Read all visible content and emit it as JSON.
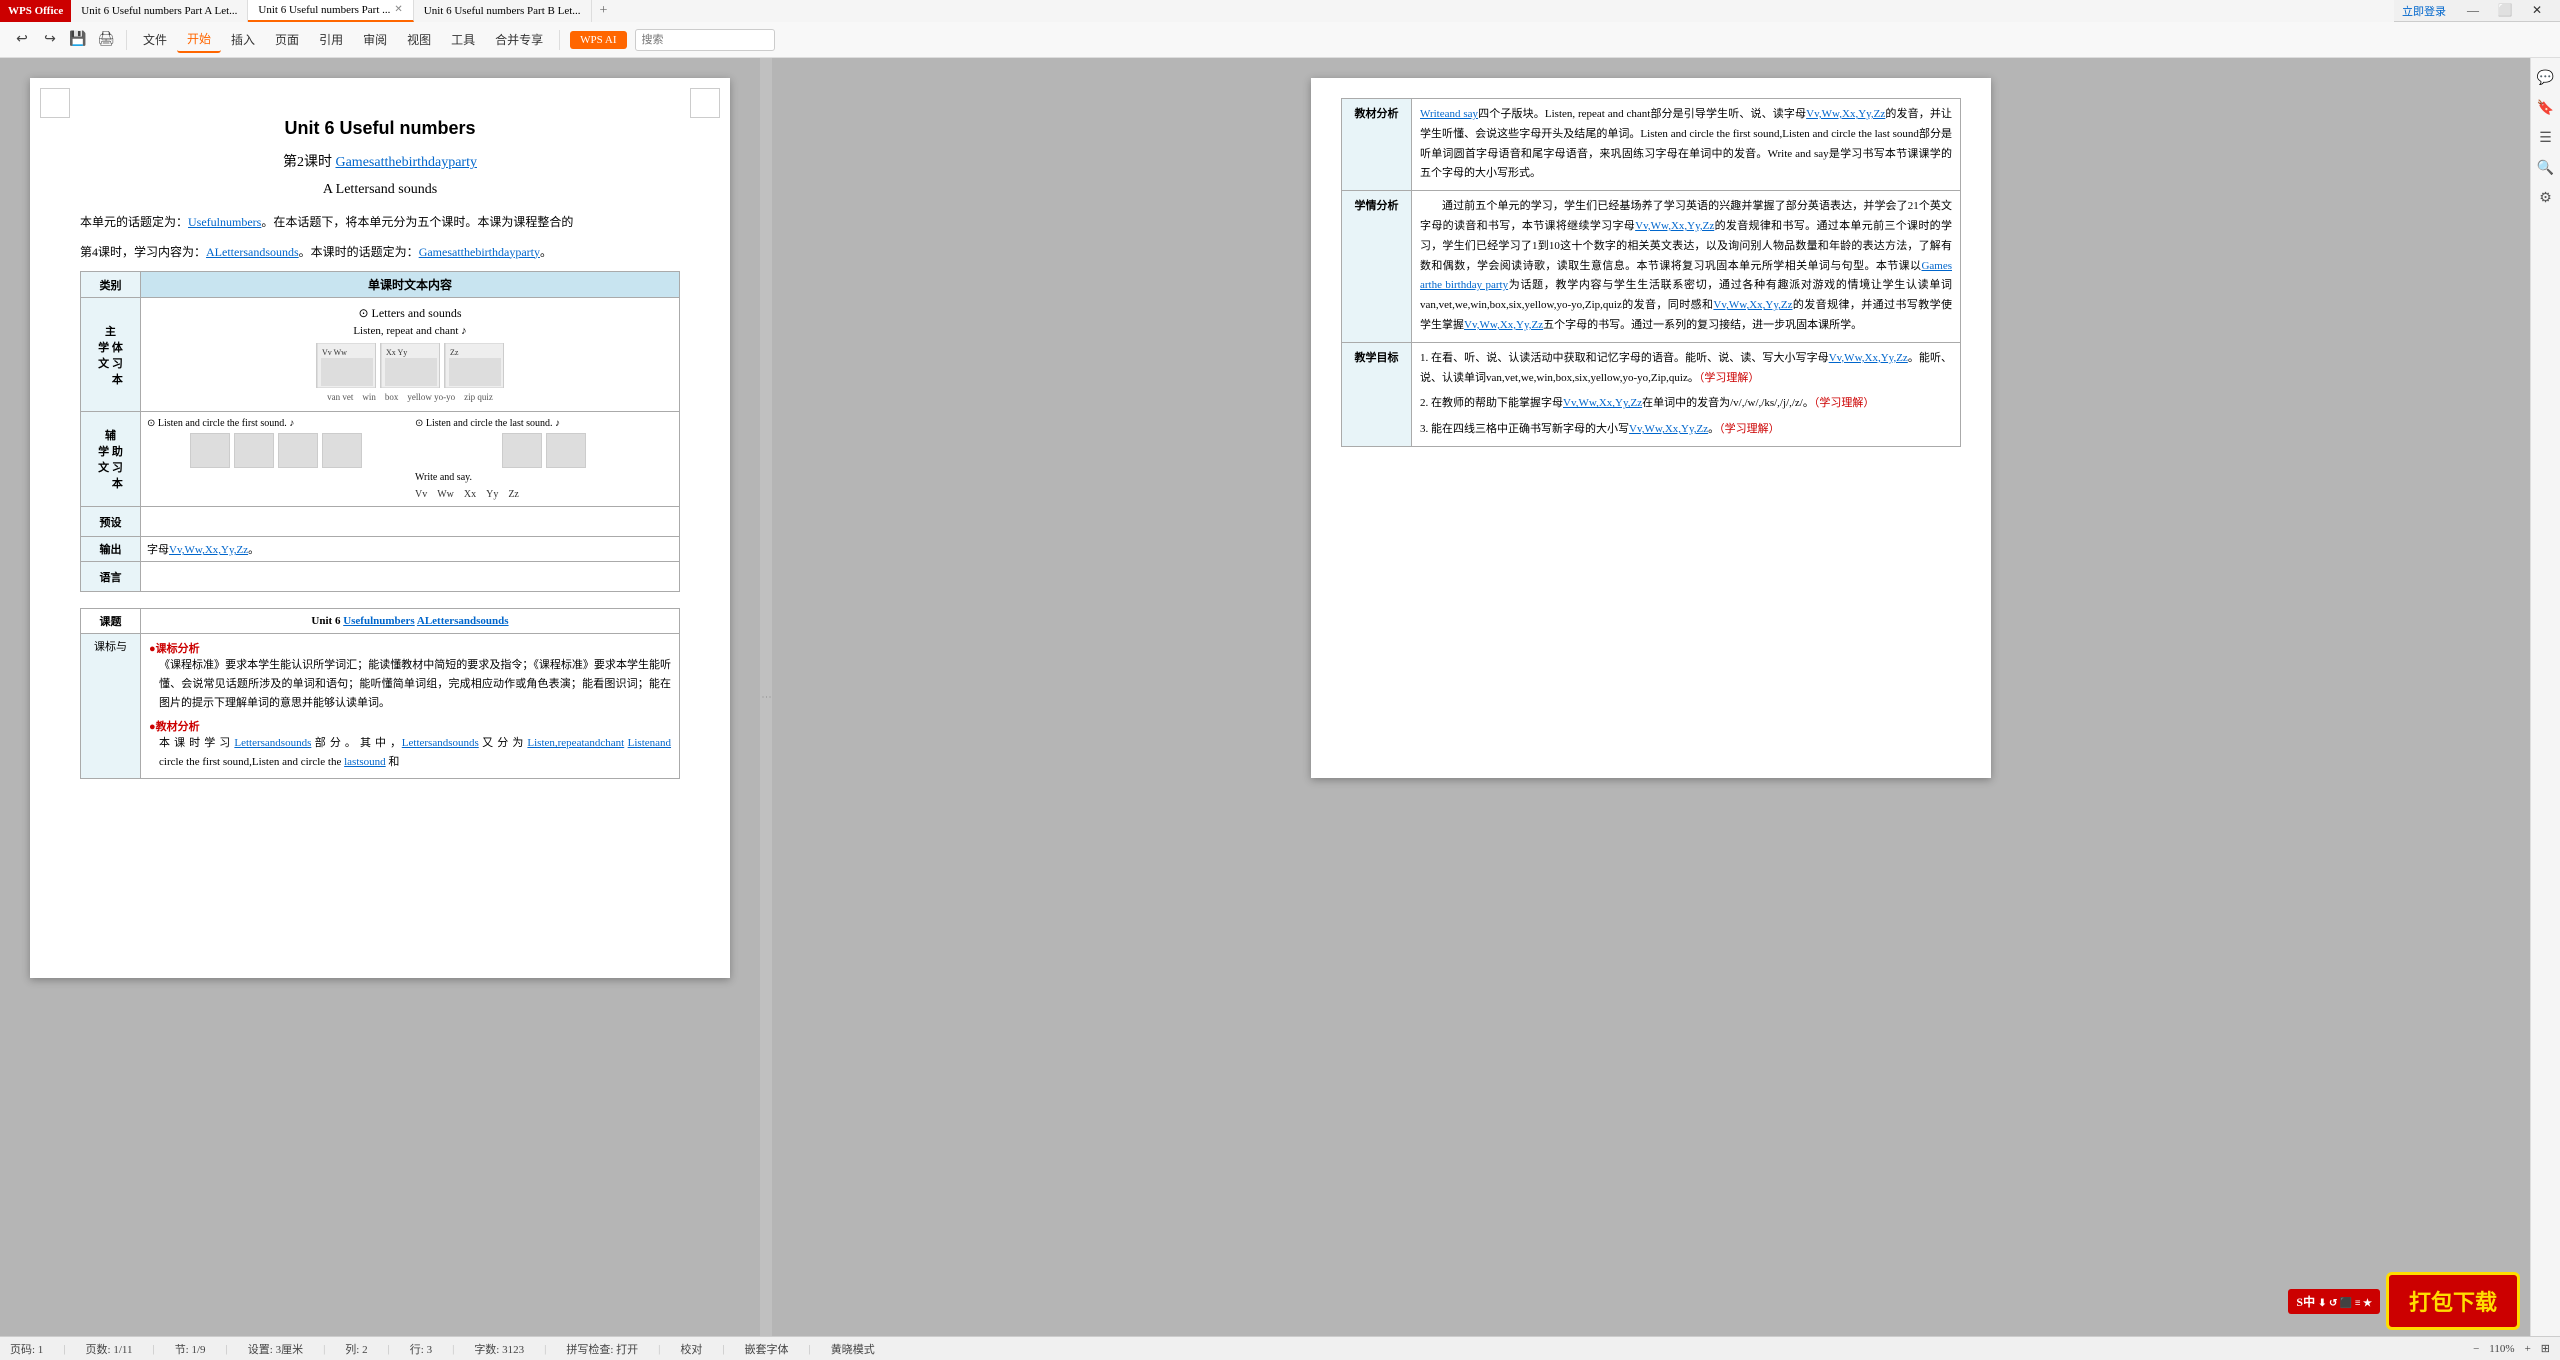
{
  "app": {
    "logo": "WPS Office",
    "tabs": [
      {
        "id": "tab1",
        "label": "Unit 6 Useful numbers Part A Let...",
        "active": false
      },
      {
        "id": "tab2",
        "label": "Unit 6 Useful numbers Part ...",
        "active": true
      },
      {
        "id": "tab3",
        "label": "Unit 6 Useful numbers Part B Let...",
        "active": false
      }
    ],
    "new_tab": "+",
    "win_controls": [
      "—",
      "⬜",
      "✕"
    ],
    "login_btn": "立即登录"
  },
  "menubar": {
    "items": [
      "文件",
      "开始",
      "插入",
      "页面",
      "引用",
      "审阅",
      "视图",
      "工具",
      "合并专享"
    ],
    "active_item": "开始",
    "wps_ai": "WPS AI",
    "search_placeholder": "搜索"
  },
  "statusbar": {
    "page": "页码: 1",
    "page_total": "页数: 1/11",
    "section": "节: 1/9",
    "size": "设置: 3厘米",
    "col": "列: 2",
    "row": "行: 3",
    "words": "字数: 3123",
    "proofread": "拼写检查: 打开",
    "align": "校对",
    "font_embed": "嵌套字体",
    "mode": "黄晓模式",
    "zoom": "110%"
  },
  "left_doc": {
    "title": "Unit 6 Useful numbers",
    "subtitle_lesson": "第2课时",
    "subtitle_games": "Gamesatthebirthdayparty",
    "subtitle_letters": "A Lettersand sounds",
    "para1": "本单元的话题定为：Usefulnumbers。在本话题下，将本单元分为五个课时。本课为课程整合的",
    "para2": "第4课时，学习内容为：ALettersandsounds。本课时的话题定为：Gamesatthebirthdayparty。",
    "table1": {
      "col1_header": "类别",
      "col2_header": "单课时文本内容",
      "row1_label": "主学文",
      "row1_sublabels": [
        "体",
        "学",
        "本"
      ],
      "row1_content_title": "Letters and sounds",
      "row1_content_sub": "Listen, repeat and chant ♪",
      "row2_label": "辅学文",
      "row2_sublabels": [
        "助",
        "习",
        "本"
      ],
      "row2_content1": "• Listen and circle the first sound. ♪",
      "row2_content2": "• Listen and circle the last sound. ♪",
      "row2_content3": "Write and say.",
      "row2_letters": "Vv  Ww  Xx  Yy  Zz",
      "row3_label": "预设",
      "row3_content": "",
      "row4_label": "输出",
      "row4_content": "字母Vv,Ww,Xx,Yy,Zz。",
      "row5_label": "语言",
      "row5_content": ""
    },
    "table2": {
      "col1_header": "课题",
      "col2_header": "Unit 6 Usefulnumbers ALettersandsounds",
      "row1_label": "课标与",
      "row1_content": [
        "• 课标分析",
        "《课程标准》要求本学生能认识所学词汇；能读懂教材中简短的要求及指令；《课程标准》要求本学生能听懂、会说常见话题所涉及的单词和语句；能听懂简单词组，完成相应动作或角色表演；能看图识词；能在图片的提示下理解单词的意思并能够认读单词。",
        "• 教材分析",
        "本 课 时 学 习 Lettersandsounds 部 分 。 其 中 ，Lettersandsounds 又 分 为 Listen,repeatandchant Listenand circle the first sound,Listen and circle the lastsound 和"
      ]
    }
  },
  "right_doc": {
    "table": {
      "rows": [
        {
          "label": "教材分析",
          "content": "Writeand say四个子版块。Listen, repeat and chant部分是引导学生听、说、读字母Vv,Ww,Xx,Yy,Zz的发音，并让学生听懂、会说这些字母开头及结尾的单词。Listen and circle the first sound,Listen and circle the last sound部分是听单词圆首字母语音和尾字母语音，来巩固练习字母在单词中的发音。Write and say是学习书写本节课课学的五个字母的大小写形式。"
        },
        {
          "label": "学情分析",
          "content": "通过前五个单元的学习，学生们已经基场养了学习英语的兴趣并掌握了部分英语表达，并学会了21个英文字母的读音和书写，本节课将继续学习字母Vv,Ww,Xx,Yy,Zz的发音规律和书写。通过本单元前三个课时的学习，学生们已经学习了1到10这十个数字的相关英文表达，以及询问别人物品数量和年龄的表达方法，了解有数和偶数，学会阅读诗歌，读取生意信息。本节课将复习巩固本单元所学相关单词与句型。本节课以Games arthe birthday party为话题，教学内容与学生生活联系密切，通过各种有趣派对游戏的情境让学生认读单词van,vet,we,win,box,six,yellow,yo-yo,Zip,quiz的发音，同时感和Vv,Ww,Xx,Yy,Zz的发音规律，并通过书写教学使学生掌握Vv,Ww,Xx,Yy,Zz五个字母的书写。通过一系列的复习接结，进一步巩固本课所学。"
        },
        {
          "label": "教学目标",
          "content": "1. 在看、听、说、认读活动中获取和记忆字母的语音。能听、说、读、写大小写字母Vv,Ww,Xx,Yy,Zz。能听、说、认读单词van,vet,we,win,box,six,yellow,yo-yo,Zip,quiz。（学习理解）\n2. 在教师的帮助下能掌握字母Vv,Ww,Xx,Yy,Zz在单词中的发音为/v/,/w/,/ks/,/j/,/z/。（学习理解）\n3. 能在四线三格中正确书写新字母的大小写Vv,Ww,Xx,Yy,Zz。（学习理解）"
        }
      ]
    },
    "download": {
      "badge": "S中",
      "btn_text": "打包下载"
    }
  }
}
